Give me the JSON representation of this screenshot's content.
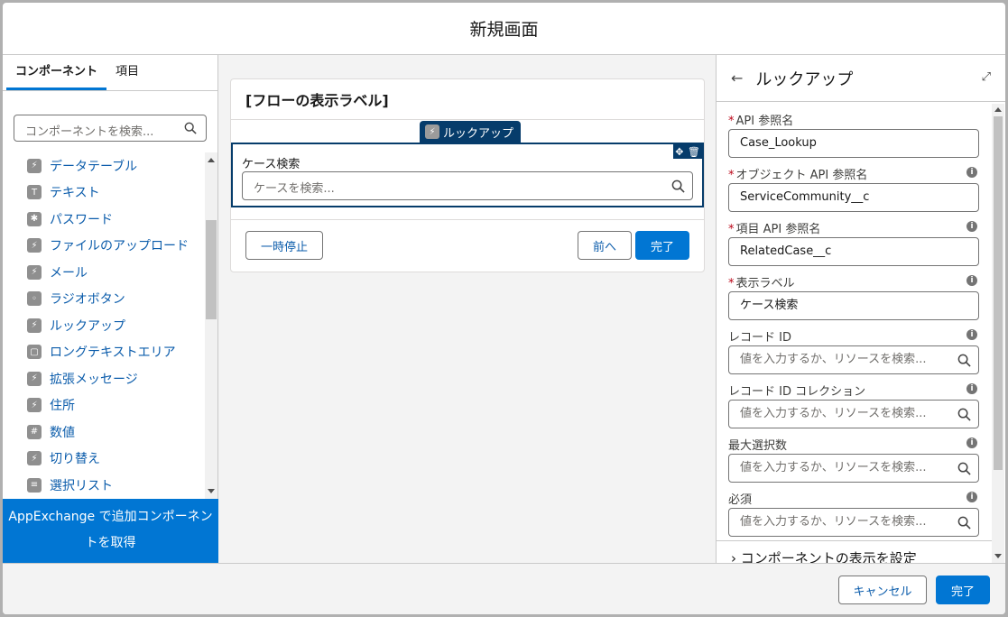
{
  "modal": {
    "title": "新規画面"
  },
  "left_panel": {
    "tabs": [
      {
        "label": "コンポーネント",
        "active": true
      },
      {
        "label": "項目",
        "active": false
      }
    ],
    "search_placeholder": "コンポーネントを検索...",
    "components": [
      {
        "label": "データテーブル",
        "icon": "bolt-icon"
      },
      {
        "label": "テキスト",
        "icon": "text-icon"
      },
      {
        "label": "パスワード",
        "icon": "password-icon"
      },
      {
        "label": "ファイルのアップロード",
        "icon": "bolt-icon"
      },
      {
        "label": "メール",
        "icon": "bolt-icon"
      },
      {
        "label": "ラジオボタン",
        "icon": "radio-icon"
      },
      {
        "label": "ルックアップ",
        "icon": "bolt-icon"
      },
      {
        "label": "ロングテキストエリア",
        "icon": "textarea-icon"
      },
      {
        "label": "拡張メッセージ",
        "icon": "bolt-icon"
      },
      {
        "label": "住所",
        "icon": "bolt-icon"
      },
      {
        "label": "数値",
        "icon": "number-icon"
      },
      {
        "label": "切り替え",
        "icon": "bolt-icon"
      },
      {
        "label": "選択リスト",
        "icon": "list-icon"
      }
    ],
    "appexchange_line1": "AppExchange で追加コンポーネン",
    "appexchange_line2": "トを取得"
  },
  "canvas": {
    "flow_title": "[フローの表示ラベル]",
    "selected_tag": "ルックアップ",
    "component_label": "ケース検索",
    "component_placeholder": "ケースを検索...",
    "pause_button": "一時停止",
    "prev_button": "前へ",
    "finish_button": "完了"
  },
  "right_panel": {
    "title": "ルックアップ",
    "fields": {
      "api_name": {
        "label": "API 参照名",
        "value": "Case_Lookup"
      },
      "object_api_name": {
        "label": "オブジェクト API 参照名",
        "value": "ServiceCommunity__c"
      },
      "field_api_name": {
        "label": "項目 API 参照名",
        "value": "RelatedCase__c"
      },
      "display_label": {
        "label": "表示ラベル",
        "value": "ケース検索"
      },
      "record_id": {
        "label": "レコード ID",
        "placeholder": "値を入力するか、リソースを検索..."
      },
      "record_id_collection": {
        "label": "レコード ID コレクション",
        "placeholder": "値を入力するか、リソースを検索..."
      },
      "max_selections": {
        "label": "最大選択数",
        "placeholder": "値を入力するか、リソースを検索..."
      },
      "required": {
        "label": "必須",
        "placeholder": "値を入力するか、リソースを検索..."
      }
    },
    "section_link": "コンポーネントの表示を設定"
  },
  "footer": {
    "cancel_button": "キャンセル",
    "done_button": "完了"
  },
  "colors": {
    "brand": "#0176d3",
    "selection": "#063c6b",
    "link": "#0b5cab",
    "required": "#ba0517"
  }
}
